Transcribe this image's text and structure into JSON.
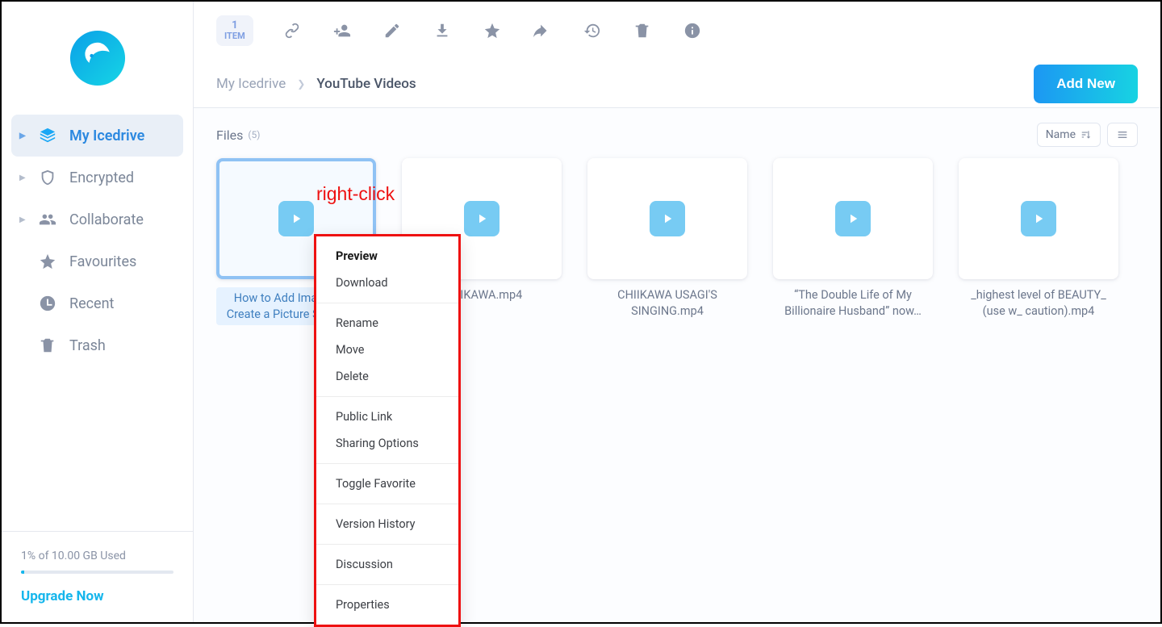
{
  "sidebar": {
    "items": [
      {
        "label": "My Icedrive",
        "active": true
      },
      {
        "label": "Encrypted"
      },
      {
        "label": "Collaborate"
      },
      {
        "label": "Favourites"
      },
      {
        "label": "Recent"
      },
      {
        "label": "Trash"
      }
    ]
  },
  "storage": {
    "text": "1% of 10.00 GB Used",
    "upgrade": "Upgrade Now"
  },
  "toolbar": {
    "count_num": "1",
    "count_label": "ITEM"
  },
  "breadcrumb": {
    "root": "My Icedrive",
    "current": "YouTube Videos",
    "add_new": "Add New"
  },
  "files_header": {
    "label": "Files",
    "count": "(5)",
    "sort": "Name"
  },
  "files": [
    {
      "name": "How to Add Images and Create a Picture Slideshow"
    },
    {
      "name": "CHIIKAWA.mp4"
    },
    {
      "name": "CHIIKAWA USAGI'S SINGING.mp4"
    },
    {
      "name": "“The Double Life of My Billionaire Husband” now…"
    },
    {
      "name": "_highest level of BEAUTY_ (use w_ caution).mp4"
    }
  ],
  "context_menu": {
    "groups": [
      [
        "Preview",
        "Download"
      ],
      [
        "Rename",
        "Move",
        "Delete"
      ],
      [
        "Public Link",
        "Sharing Options"
      ],
      [
        "Toggle Favorite"
      ],
      [
        "Version History"
      ],
      [
        "Discussion"
      ],
      [
        "Properties"
      ]
    ]
  },
  "annotation": "right-click"
}
